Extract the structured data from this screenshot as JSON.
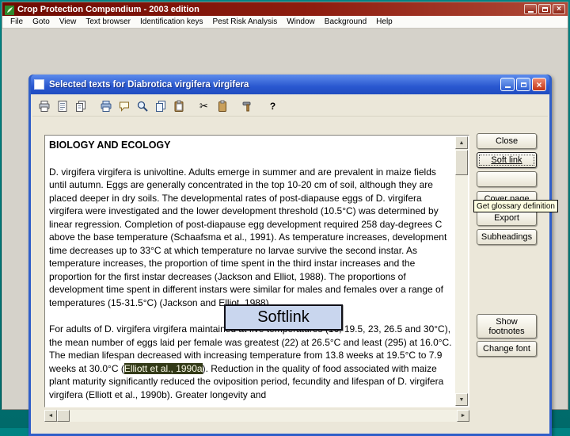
{
  "app": {
    "title": "Crop Protection Compendium - 2003 edition",
    "menu": [
      "File",
      "Goto",
      "View",
      "Text browser",
      "Identification keys",
      "Pest Risk Analysis",
      "Window",
      "Background",
      "Help"
    ]
  },
  "icons": {
    "close": "×",
    "scroll_up": "▲",
    "scroll_down": "▼",
    "scroll_left": "◄",
    "scroll_right": "►",
    "cut": "✂",
    "help": "?"
  },
  "doc_window": {
    "title": "Selected texts for Diabrotica virgifera virgifera",
    "toolbar_icons": [
      "print-icon",
      "view-text-icon",
      "copy-pages-icon",
      "print-selection-icon",
      "annotation-icon",
      "search-icon",
      "copy-icon",
      "paste-icon",
      "cut-icon",
      "clipboard-icon",
      "tools-icon",
      "help-icon"
    ],
    "side_buttons": {
      "close": "Close",
      "soft_link": "Soft link",
      "hidden": "",
      "cover_page": "Cover page",
      "export": "Export",
      "subheadings": "Subheadings",
      "show_footnotes": "Show footnotes",
      "change_font": "Change font"
    },
    "tooltip": "Get glossary definition",
    "softlink_popup": "Softlink",
    "document": {
      "heading": "BIOLOGY AND ECOLOGY",
      "paragraph1": "D. virgifera virgifera is univoltine. Adults emerge in summer and are prevalent in maize fields until autumn. Eggs are generally concentrated in the top 10-20 cm of soil, although they are placed deeper in dry soils. The developmental rates of post-diapause eggs of D. virgifera virgifera were investigated and the lower development threshold (10.5°C) was determined by linear regression. Completion of post-diapause egg development required 258 day-degrees C above the base temperature (Schaafsma et al., 1991). As temperature increases, development time decreases up to 33°C at which temperature no larvae survive the second instar. As temperature increases, the proportion of time spent in the third instar increases and the proportion for the first instar decreases (Jackson and Elliot, 1988). The proportions of development time spent in different instars were similar for males and females over a range of temperatures (15-31.5°C) (Jackson and Elliot, 1988).",
      "paragraph2_before": "For adults of D. virgifera virgifera maintained at five temperatures (16, 19.5, 23, 26.5 and 30°C), the mean number of eggs laid per female was greatest (22) at 26.5°C and least (295) at 16.0°C. The median lifespan decreased with increasing temperature from 13.8 weeks at 19.5°C to 7.9 weeks at 30.0°C (",
      "citation_highlight": "Elliott et al., 1990a",
      "paragraph2_after": "). Reduction in the quality of food associated with maize plant maturity significantly reduced the oviposition period, fecundity and lifespan of D. virgifera virgifera (Elliott et al., 1990b). Greater longevity and"
    }
  }
}
